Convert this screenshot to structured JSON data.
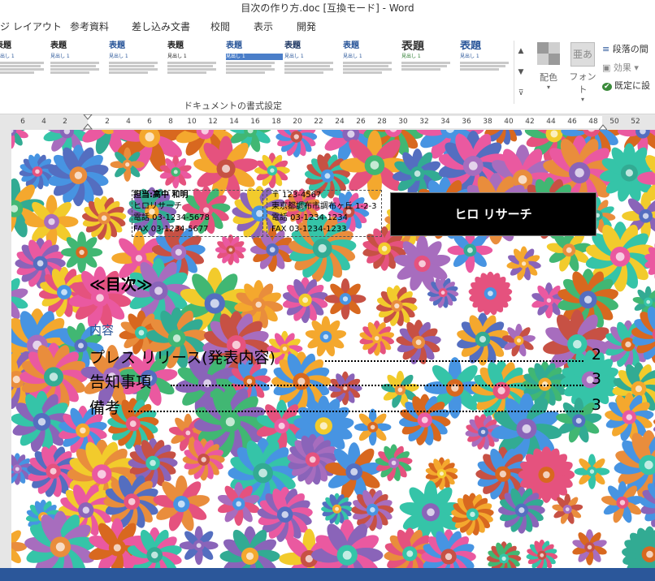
{
  "window": {
    "title": "目次の作り方.doc [互換モード] - Word"
  },
  "tabs": [
    "ジ レイアウト",
    "参考資料",
    "差し込み文書",
    "校閲",
    "表示",
    "開発"
  ],
  "ribbon": {
    "styles": [
      {
        "title": "表題",
        "sub": "見出し 1"
      },
      {
        "title": "表題",
        "sub": "見出し 1"
      },
      {
        "title": "表題",
        "sub": "見出し 1"
      },
      {
        "title": "表題",
        "sub": "見出し 1"
      },
      {
        "title": "表題",
        "sub": "見出し 1"
      },
      {
        "title": "表題",
        "sub": "見出し 1"
      },
      {
        "title": "表題",
        "sub": "見出し 1"
      },
      {
        "title": "表題",
        "sub": "見出し 1"
      },
      {
        "title": "表題",
        "sub": "見出し 1"
      }
    ],
    "group_label": "ドキュメントの書式設定",
    "color_label": "配色",
    "font_label": "フォント",
    "font_icon_text": "亜あ",
    "paragraph_spacing": "段落の間",
    "effects": "効果",
    "set_default": "既定に設"
  },
  "ruler": {
    "ticks": [
      "6",
      "4",
      "2",
      "",
      "2",
      "4",
      "6",
      "8",
      "10",
      "12",
      "14",
      "16",
      "18",
      "20",
      "22",
      "24",
      "26",
      "28",
      "30",
      "32",
      "34",
      "36",
      "38",
      "40",
      "42",
      "44",
      "46",
      "48",
      "50",
      "52"
    ]
  },
  "document": {
    "header_left": [
      "担当:高中 和明",
      "ヒロリサーチ",
      "電話 03-1234-5678",
      "FAX 03-1234-5677"
    ],
    "header_mid": [
      "〒 123-4567",
      "東京都調布市調布ヶ丘 1-2-3",
      "電話 03-1234-1234",
      "FAX 03-1234-1233"
    ],
    "company": "ヒロ リサーチ",
    "toc_title": "≪目次≫",
    "toc_heading": "内容",
    "toc": [
      {
        "label": "プレス リリース(発表内容)",
        "page": "2"
      },
      {
        "label": "告知事項",
        "page": "3"
      },
      {
        "label": "備考",
        "page": "3"
      }
    ]
  },
  "colors": {
    "accent": "#2b579a",
    "status": "#2b579a"
  }
}
